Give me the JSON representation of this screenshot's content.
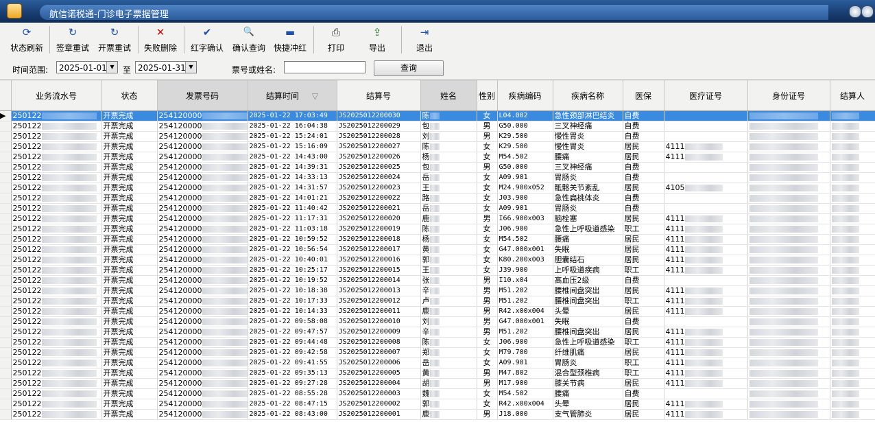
{
  "window": {
    "title": "航信诺税通-门诊电子票据管理"
  },
  "toolbar": {
    "buttons": [
      {
        "label": "状态刷新",
        "icon": "refresh-icon",
        "glyph": "⟳",
        "color": "#1f4fa8"
      },
      {
        "label": "签章重试",
        "icon": "retry-icon",
        "glyph": "↻",
        "color": "#1f4fa8"
      },
      {
        "label": "开票重试",
        "icon": "retry-icon",
        "glyph": "↻",
        "color": "#1f4fa8"
      },
      {
        "label": "失败删除",
        "icon": "delete-x-icon",
        "glyph": "✕",
        "color": "#cc1111"
      },
      {
        "label": "红字确认",
        "icon": "checkmark-icon",
        "glyph": "✔",
        "color": "#1f4fa8"
      },
      {
        "label": "确认查询",
        "icon": "document-search-icon",
        "glyph": "🔍",
        "color": "#333333"
      },
      {
        "label": "快捷冲红",
        "icon": "minus-icon",
        "glyph": "▬",
        "color": "#1f4fa8"
      },
      {
        "label": "打印",
        "icon": "printer-icon",
        "glyph": "⎙",
        "color": "#333333"
      },
      {
        "label": "导出",
        "icon": "export-icon",
        "glyph": "⇪",
        "color": "#2a7a2a"
      },
      {
        "label": "退出",
        "icon": "exit-door-icon",
        "glyph": "⇥",
        "color": "#1f4fa8"
      }
    ]
  },
  "filter": {
    "time_range_label": "时间范围:",
    "date_from": "2025-01-01",
    "to_label": "至",
    "date_to": "2025-01-31",
    "ticket_or_name_label": "票号或姓名:",
    "ticket_or_name_value": "",
    "query_button": "查询"
  },
  "grid": {
    "columns": [
      "业务流水号",
      "状态",
      "发票号码",
      "结算时间",
      "结算号",
      "姓名",
      "性别",
      "疾病编码",
      "疾病名称",
      "医保",
      "医疗证号",
      "身份证号",
      "结算人"
    ],
    "sort_indicator": "▽",
    "rows": [
      [
        "250122",
        "开票完成",
        "254120000",
        "2025-01-22 17:03:49",
        "JS2025012200030",
        "陈",
        "女",
        "L04.002",
        "急性颈部淋巴结炎",
        "自费",
        ""
      ],
      [
        "250122",
        "开票完成",
        "254120000",
        "2025-01-22 16:04:38",
        "JS2025012200029",
        "包",
        "男",
        "G50.000",
        "三叉神经痛",
        "自费",
        ""
      ],
      [
        "250122",
        "开票完成",
        "254120000",
        "2025-01-22 15:24:01",
        "JS2025012200028",
        "刘",
        "男",
        "K29.500",
        "慢性胃炎",
        "自费",
        ""
      ],
      [
        "250122",
        "开票完成",
        "254120000",
        "2025-01-22 15:16:09",
        "JS2025012200027",
        "陈",
        "女",
        "K29.500",
        "慢性胃炎",
        "居民",
        "4111"
      ],
      [
        "250122",
        "开票完成",
        "254120000",
        "2025-01-22 14:43:00",
        "JS2025012200026",
        "杨",
        "女",
        "M54.502",
        "腰痛",
        "居民",
        "4111"
      ],
      [
        "250122",
        "开票完成",
        "254120000",
        "2025-01-22 14:39:31",
        "JS2025012200025",
        "包",
        "男",
        "G50.000",
        "三叉神经痛",
        "自费",
        ""
      ],
      [
        "250122",
        "开票完成",
        "254120000",
        "2025-01-22 14:33:13",
        "JS2025012200024",
        "岳",
        "女",
        "A09.901",
        "胃肠炎",
        "自费",
        ""
      ],
      [
        "250122",
        "开票完成",
        "254120000",
        "2025-01-22 14:31:57",
        "JS2025012200023",
        "王",
        "女",
        "M24.900x052",
        "骶髂关节紊乱",
        "居民",
        "4105"
      ],
      [
        "250122",
        "开票完成",
        "254120000",
        "2025-01-22 14:01:21",
        "JS2025012200022",
        "路",
        "女",
        "J03.900",
        "急性扁桃体炎",
        "自费",
        ""
      ],
      [
        "250122",
        "开票完成",
        "254120000",
        "2025-01-22 11:40:42",
        "JS2025012200021",
        "岳",
        "女",
        "A09.901",
        "胃肠炎",
        "自费",
        ""
      ],
      [
        "250122",
        "开票完成",
        "254120000",
        "2025-01-22 11:17:31",
        "JS2025012200020",
        "鹿",
        "男",
        "I66.900x003",
        "脑栓塞",
        "居民",
        "4111"
      ],
      [
        "250122",
        "开票完成",
        "254120000",
        "2025-01-22 11:03:18",
        "JS2025012200019",
        "陈",
        "女",
        "J06.900",
        "急性上呼吸道感染",
        "职工",
        "4111"
      ],
      [
        "250122",
        "开票完成",
        "254120000",
        "2025-01-22 10:59:52",
        "JS2025012200018",
        "杨",
        "女",
        "M54.502",
        "腰痛",
        "居民",
        "4111"
      ],
      [
        "250122",
        "开票完成",
        "254120000",
        "2025-01-22 10:56:54",
        "JS2025012200017",
        "黄",
        "女",
        "G47.000x001",
        "失眠",
        "居民",
        "4111"
      ],
      [
        "250122",
        "开票完成",
        "254120000",
        "2025-01-22 10:40:01",
        "JS2025012200016",
        "郭",
        "女",
        "K80.200x003",
        "胆囊结石",
        "居民",
        "4111"
      ],
      [
        "250122",
        "开票完成",
        "254120000",
        "2025-01-22 10:25:17",
        "JS2025012200015",
        "王",
        "女",
        "J39.900",
        "上呼吸道疾病",
        "职工",
        "4111"
      ],
      [
        "250122",
        "开票完成",
        "254120000",
        "2025-01-22 10:19:52",
        "JS2025012200014",
        "张",
        "男",
        "I10.x04",
        "高血压2级",
        "自费",
        ""
      ],
      [
        "250122",
        "开票完成",
        "254120000",
        "2025-01-22 10:18:38",
        "JS2025012200013",
        "辛",
        "男",
        "M51.202",
        "腰椎间盘突出",
        "居民",
        "4111"
      ],
      [
        "250122",
        "开票完成",
        "254120000",
        "2025-01-22 10:17:33",
        "JS2025012200012",
        "卢",
        "男",
        "M51.202",
        "腰椎间盘突出",
        "职工",
        "4111"
      ],
      [
        "250122",
        "开票完成",
        "254120000",
        "2025-01-22 10:14:33",
        "JS2025012200011",
        "鹿",
        "男",
        "R42.x00x004",
        "头晕",
        "居民",
        "4111"
      ],
      [
        "250122",
        "开票完成",
        "254120000",
        "2025-01-22 09:58:08",
        "JS2025012200010",
        "刘",
        "男",
        "G47.000x001",
        "失眠",
        "自费",
        ""
      ],
      [
        "250122",
        "开票完成",
        "254120000",
        "2025-01-22 09:47:57",
        "JS2025012200009",
        "辛",
        "男",
        "M51.202",
        "腰椎间盘突出",
        "居民",
        "4111"
      ],
      [
        "250122",
        "开票完成",
        "254120000",
        "2025-01-22 09:44:48",
        "JS2025012200008",
        "陈",
        "女",
        "J06.900",
        "急性上呼吸道感染",
        "职工",
        "4111"
      ],
      [
        "250122",
        "开票完成",
        "254120000",
        "2025-01-22 09:42:58",
        "JS2025012200007",
        "郑",
        "女",
        "M79.700",
        "纤维肌痛",
        "居民",
        "4111"
      ],
      [
        "250122",
        "开票完成",
        "254120000",
        "2025-01-22 09:41:55",
        "JS2025012200006",
        "岳",
        "女",
        "A09.901",
        "胃肠炎",
        "职工",
        "4111"
      ],
      [
        "250122",
        "开票完成",
        "254120000",
        "2025-01-22 09:35:13",
        "JS2025012200005",
        "黄",
        "男",
        "M47.802",
        "混合型颈椎病",
        "职工",
        "4111"
      ],
      [
        "250122",
        "开票完成",
        "254120000",
        "2025-01-22 09:27:28",
        "JS2025012200004",
        "胡",
        "男",
        "M17.900",
        "膝关节病",
        "居民",
        "4111"
      ],
      [
        "250122",
        "开票完成",
        "254120000",
        "2025-01-22 08:55:28",
        "JS2025012200003",
        "魏",
        "女",
        "M54.502",
        "腰痛",
        "自费",
        ""
      ],
      [
        "250122",
        "开票完成",
        "254120000",
        "2025-01-22 08:47:15",
        "JS2025012200002",
        "郭",
        "女",
        "R42.x00x004",
        "头晕",
        "居民",
        "4111"
      ],
      [
        "250122",
        "开票完成",
        "254120000",
        "2025-01-22 08:43:00",
        "JS2025012200001",
        "鹿",
        "男",
        "J18.000",
        "支气管肺炎",
        "居民",
        "4111"
      ]
    ]
  }
}
